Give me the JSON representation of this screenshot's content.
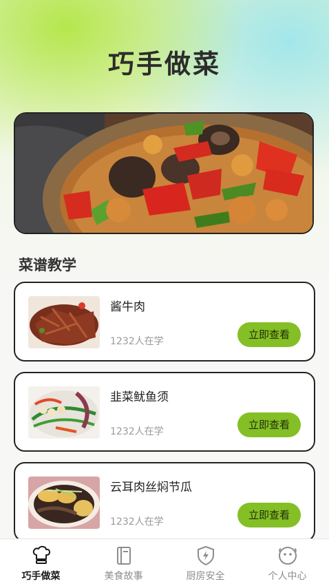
{
  "app": {
    "title": "巧手做菜"
  },
  "hero": {
    "image": "braised-chicken-mushroom-pepper-dish"
  },
  "section": {
    "title": "菜谱教学"
  },
  "recipes": [
    {
      "name": "酱牛肉",
      "learners": "1232人在学",
      "button": "立即查看",
      "thumb": "braised-beef-slices"
    },
    {
      "name": "韭菜鱿鱼须",
      "learners": "1232人在学",
      "button": "立即查看",
      "thumb": "squid-with-chives"
    },
    {
      "name": "云耳肉丝焖节瓜",
      "learners": "1232人在学",
      "button": "立即查看",
      "thumb": "wood-ear-pork-melon"
    }
  ],
  "tabs": [
    {
      "label": "巧手做菜",
      "icon": "chef-hat-icon",
      "active": true
    },
    {
      "label": "美食故事",
      "icon": "book-icon",
      "active": false
    },
    {
      "label": "厨房安全",
      "icon": "shield-bolt-icon",
      "active": false
    },
    {
      "label": "个人中心",
      "icon": "face-icon",
      "active": false
    }
  ],
  "colors": {
    "accent": "#84bf26",
    "title": "#2c2c2c",
    "tab_inactive": "#8c8c8c"
  }
}
